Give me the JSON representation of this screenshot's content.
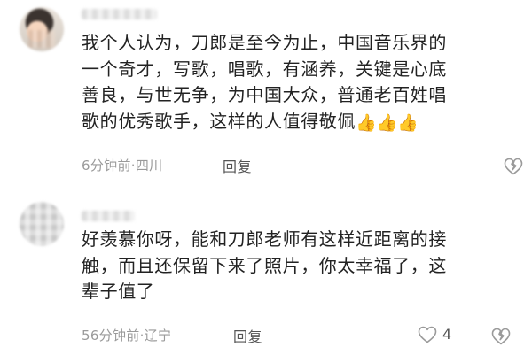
{
  "comments": [
    {
      "text_lines": "我个人认为，刀郎是至今为止，中国音乐界的\n一个奇才，写歌，唱歌，有涵养，关键是心底\n善良，与世无争，为中国大众，普通老百姓唱\n歌的优秀歌手，这样的人值得敬佩",
      "emoji": "👍👍👍",
      "time": "6分钟前",
      "separator": "·",
      "location": "四川",
      "reply_label": "回复",
      "dislike_icon": "broken-heart-icon"
    },
    {
      "text_lines": "好羡慕你呀，能和刀郎老师有这样近距离的接\n触，而且还保留下来了照片，你太幸福了，这\n辈子值了",
      "time": "56分钟前",
      "separator": "·",
      "location": "辽宁",
      "reply_label": "回复",
      "like_icon": "heart-outline-icon",
      "like_count": "4",
      "dislike_icon": "broken-heart-icon"
    }
  ],
  "colors": {
    "text": "#222222",
    "meta": "#9a9a9a",
    "icon": "#9a9a9a"
  }
}
